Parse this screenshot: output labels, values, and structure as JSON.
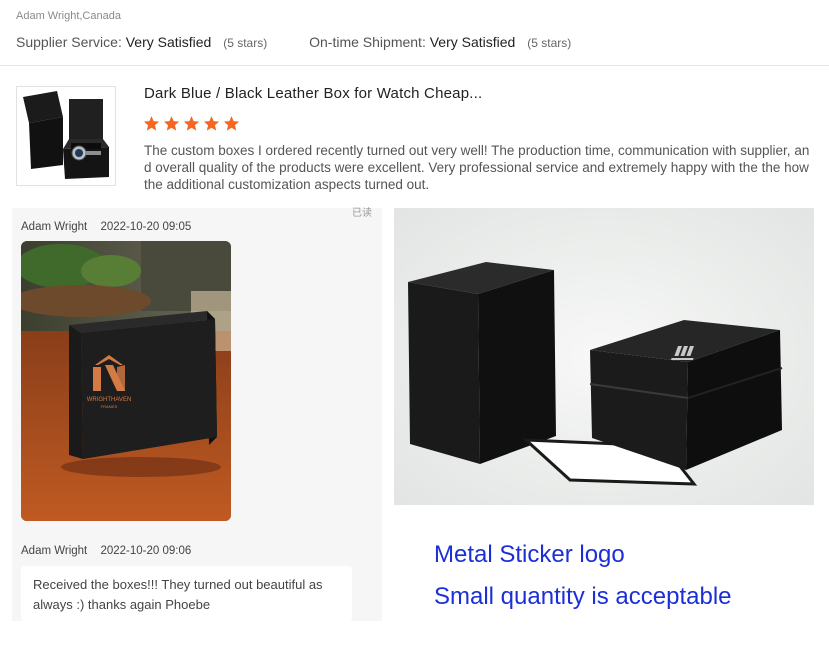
{
  "review": {
    "reviewer": "Adam Wright,Canada",
    "supplier_service_label": "Supplier Service:",
    "supplier_service_value": "Very Satisfied",
    "supplier_service_stars": "(5 stars)",
    "shipment_label": "On-time Shipment:",
    "shipment_value": "Very Satisfied",
    "shipment_stars": "(5 stars)",
    "product_title": "Dark Blue / Black Leather Box for Watch Cheap...",
    "rating": 5,
    "star_color": "#f5661e",
    "text": "The custom boxes I ordered recently turned out very well! The production time, communication with supplier, and overall quality of the products were excellent. Very professional service and extremely happy with the the how the additional customization aspects turned out."
  },
  "thread": {
    "corner_tag": "已读",
    "first": {
      "author": "Adam Wright",
      "date": "2022-10-20 09:05"
    },
    "second": {
      "author": "Adam Wright",
      "date": "2022-10-20 09:06",
      "message": "Received the boxes!!! They turned out beautiful as always :) thanks again Phoebe"
    }
  },
  "photo_logo": {
    "brand": "WRIGHTHAVEN",
    "sub": "FRAMES"
  },
  "promo": {
    "line1": "Metal Sticker logo",
    "line2": "Small quantity is acceptable",
    "color": "#1c2fd6"
  }
}
